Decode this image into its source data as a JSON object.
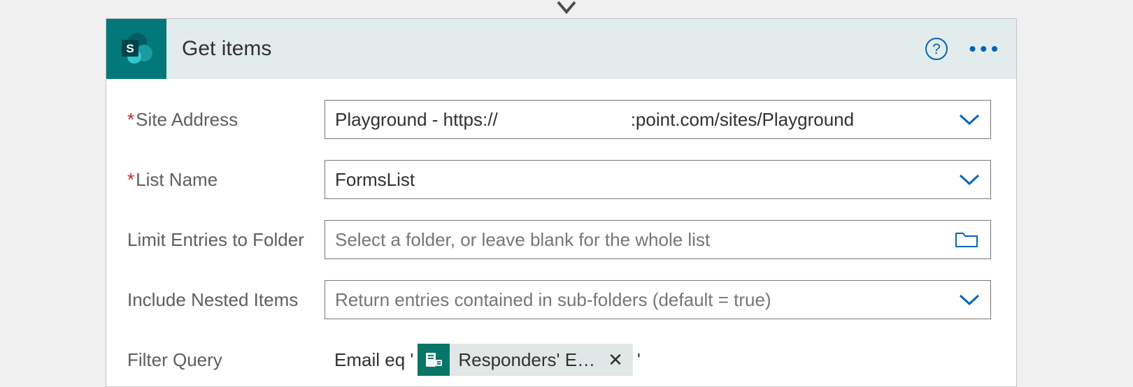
{
  "header": {
    "title": "Get items"
  },
  "fields": {
    "siteAddress": {
      "label": "Site Address",
      "required": true,
      "value_prefix": "Playground - https://",
      "value_suffix": ":point.com/sites/Playground"
    },
    "listName": {
      "label": "List Name",
      "required": true,
      "value": "FormsList"
    },
    "limitFolder": {
      "label": "Limit Entries to Folder",
      "placeholder": "Select a folder, or leave blank for the whole list"
    },
    "includeNested": {
      "label": "Include Nested Items",
      "placeholder": "Return entries contained in sub-folders (default = true)"
    },
    "filterQuery": {
      "label": "Filter Query",
      "prefix": "Email eq '",
      "token": "Responders' E…",
      "suffix": "'"
    }
  }
}
